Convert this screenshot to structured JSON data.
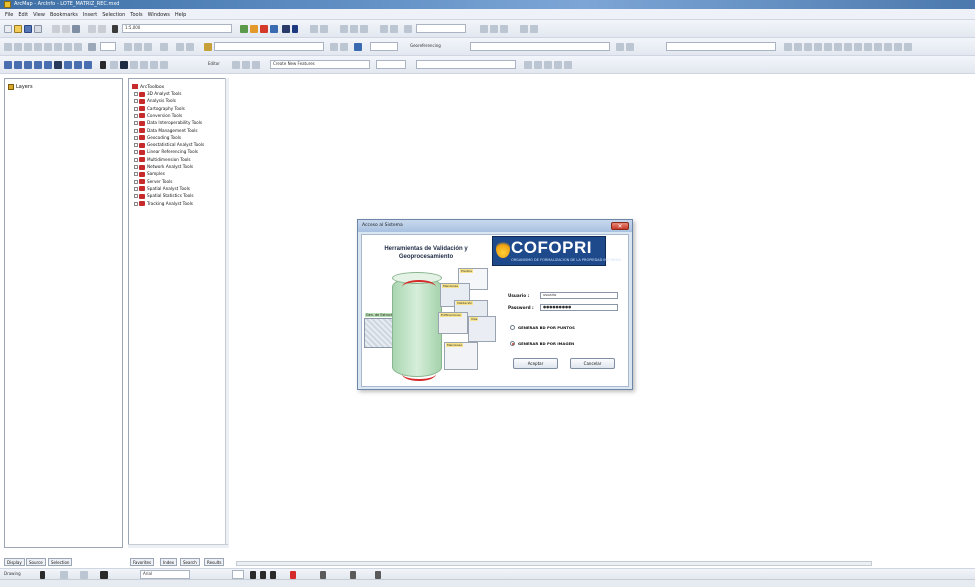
{
  "window": {
    "title": "ArcMap - ArcInfo - LOTE_MATRIZ_REC.mxd"
  },
  "menu": [
    "File",
    "Edit",
    "View",
    "Bookmarks",
    "Insert",
    "Selection",
    "Tools",
    "Windows",
    "Help"
  ],
  "toolbar": {
    "scale_value": "1:5,000",
    "editor_label": "Editor",
    "georef_label": "Georeferencing",
    "layer_combo": "Create New Features"
  },
  "toc": {
    "root_label": "Layers"
  },
  "catalog": {
    "root_label": "ArcToolbox",
    "items": [
      "3D Analyst Tools",
      "Analysis Tools",
      "Cartography Tools",
      "Conversion Tools",
      "Data Interoperability Tools",
      "Data Management Tools",
      "Geocoding Tools",
      "Geostatistical Analyst Tools",
      "Linear Referencing Tools",
      "Multidimension Tools",
      "Network Analyst Tools",
      "Samples",
      "Server Tools",
      "Spatial Analyst Tools",
      "Spatial Statistics Tools",
      "Tracking Analyst Tools"
    ]
  },
  "bottom_tabs": [
    "Display",
    "Source",
    "Selection",
    "Favorites",
    "Index",
    "Search",
    "Results"
  ],
  "drawbar": {
    "drawing_label": "Drawing",
    "font_label": "Arial"
  },
  "dialog": {
    "title": "Acceso al Sistema",
    "close": "✕",
    "heading_line1": "Herramientas de Validación y",
    "heading_line2": "Geoprocesamiento",
    "logo": "COFOPRI",
    "logo_sub": "ORGANISMO DE FORMALIZACION DE LA PROPIEDAD INFORMAL",
    "illus_labels": {
      "grid": "Gen. de Estructura",
      "p1": "Predios",
      "p2": "Manzanas",
      "p3": "Validación",
      "p4": "Edificaciones",
      "p5": "Vías",
      "p6": "Manzaneo"
    },
    "user_label": "Usuario :",
    "user_value": "usuario",
    "pass_label": "Password :",
    "pass_value": "●●●●●●●●●",
    "radio1": "GENERAR BD POR PUNTOS",
    "radio2": "GENERAR BD POR IMAGEN",
    "radio2_selected": true,
    "accept": "Aceptar",
    "cancel": "Cancelar"
  }
}
